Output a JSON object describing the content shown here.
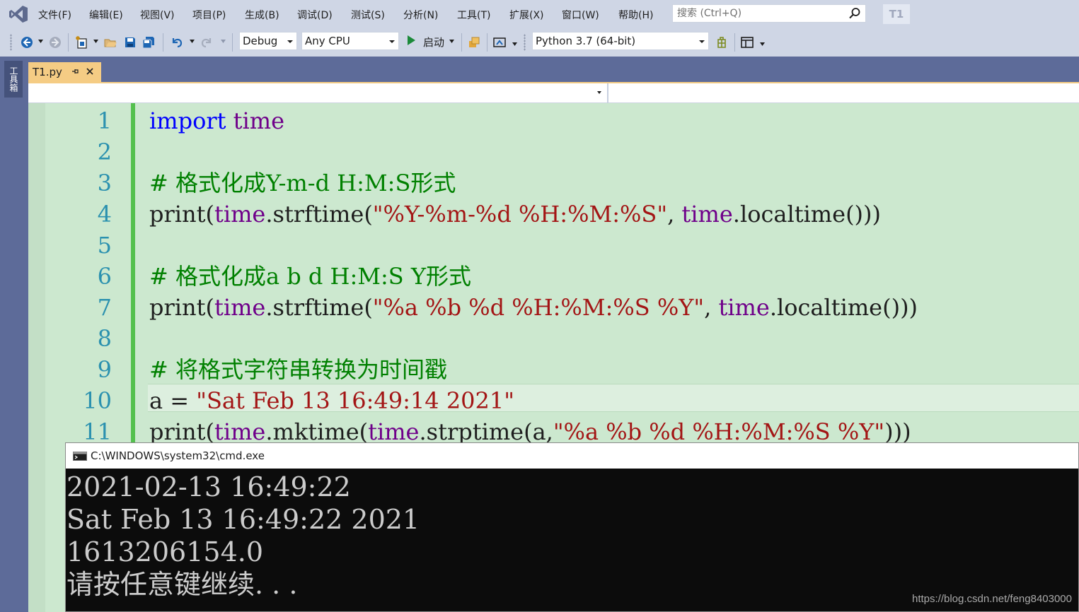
{
  "menubar": {
    "items": [
      "文件(F)",
      "编辑(E)",
      "视图(V)",
      "项目(P)",
      "生成(B)",
      "调试(D)",
      "测试(S)",
      "分析(N)",
      "工具(T)",
      "扩展(X)",
      "窗口(W)",
      "帮助(H)"
    ],
    "search_placeholder": "搜索 (Ctrl+Q)",
    "solution_badge": "T1"
  },
  "toolbar": {
    "configuration": "Debug",
    "platform": "Any CPU",
    "start_label": "启动",
    "environment": "Python 3.7 (64-bit)"
  },
  "toolbox": {
    "label": "工具箱"
  },
  "tabs": [
    {
      "label": "T1.py"
    }
  ],
  "editor": {
    "line_numbers": [
      "1",
      "2",
      "3",
      "4",
      "5",
      "6",
      "7",
      "8",
      "9",
      "10",
      "11"
    ],
    "lines": [
      [
        {
          "t": "import",
          "c": "kw"
        },
        {
          "t": " "
        },
        {
          "t": "time",
          "c": "mod"
        }
      ],
      [],
      [
        {
          "t": "# 格式化成Y-m-d H:M:S形式",
          "c": "cm"
        }
      ],
      [
        {
          "t": "print("
        },
        {
          "t": "time",
          "c": "mod"
        },
        {
          "t": ".strftime("
        },
        {
          "t": "\"%Y-%m-%d %H:%M:%S\"",
          "c": "str"
        },
        {
          "t": ", "
        },
        {
          "t": "time",
          "c": "mod"
        },
        {
          "t": ".localtime()))"
        }
      ],
      [],
      [
        {
          "t": "# 格式化成a b d H:M:S Y形式",
          "c": "cm"
        }
      ],
      [
        {
          "t": "print("
        },
        {
          "t": "time",
          "c": "mod"
        },
        {
          "t": ".strftime("
        },
        {
          "t": "\"%a %b %d %H:%M:%S %Y\"",
          "c": "str"
        },
        {
          "t": ", "
        },
        {
          "t": "time",
          "c": "mod"
        },
        {
          "t": ".localtime()))"
        }
      ],
      [],
      [
        {
          "t": "# 将格式字符串转换为时间戳",
          "c": "cm"
        }
      ],
      [
        {
          "t": "a = "
        },
        {
          "t": "\"Sat Feb 13 16:49:14 2021\"",
          "c": "str"
        }
      ],
      [
        {
          "t": "print("
        },
        {
          "t": "time",
          "c": "mod"
        },
        {
          "t": ".mktime("
        },
        {
          "t": "time",
          "c": "mod"
        },
        {
          "t": ".strptime(a,"
        },
        {
          "t": "\"%a %b %d %H:%M:%S %Y\"",
          "c": "str"
        },
        {
          "t": ")))"
        }
      ]
    ]
  },
  "console": {
    "title": "C:\\WINDOWS\\system32\\cmd.exe",
    "lines": [
      "2021-02-13 16:49:22",
      "Sat Feb 13 16:49:22 2021",
      "1613206154.0",
      "请按任意键继续. . ."
    ]
  },
  "watermark": "https://blog.csdn.net/feng8403000",
  "colors": {
    "editor_background": "#cce8cf",
    "keyword": "#0000ff",
    "module": "#6f008a",
    "comment": "#008000",
    "string": "#a31515",
    "line_number": "#2b91af",
    "active_tab": "#f5cc84"
  },
  "icons": [
    "vs-logo-icon",
    "search-icon",
    "back-icon",
    "forward-icon",
    "new-project-icon",
    "open-folder-icon",
    "save-icon",
    "save-all-icon",
    "undo-icon",
    "redo-icon",
    "play-icon",
    "find-in-files-icon",
    "browser-link-icon",
    "extension-icon",
    "layout-icon",
    "pin-icon",
    "close-icon",
    "cmd-icon"
  ]
}
